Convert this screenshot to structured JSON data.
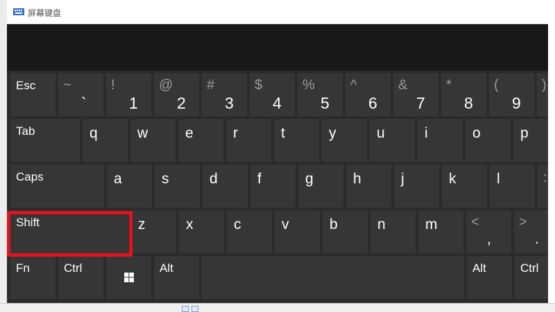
{
  "window": {
    "title": "屏幕键盘",
    "title_icon": "keyboard-icon"
  },
  "keys": {
    "esc": "Esc",
    "tab": "Tab",
    "caps": "Caps",
    "shift": "Shift",
    "fn": "Fn",
    "ctrl_left": "Ctrl",
    "alt_left": "Alt",
    "alt_right": "Alt",
    "ctrl_right": "Ctrl",
    "windows": "windows-logo-icon"
  },
  "number_row": [
    {
      "top": "~",
      "bottom": "`"
    },
    {
      "top": "!",
      "bottom": "1"
    },
    {
      "top": "@",
      "bottom": "2"
    },
    {
      "top": "#",
      "bottom": "3"
    },
    {
      "top": "$",
      "bottom": "4"
    },
    {
      "top": "%",
      "bottom": "5"
    },
    {
      "top": "^",
      "bottom": "6"
    },
    {
      "top": "&",
      "bottom": "7"
    },
    {
      "top": "*",
      "bottom": "8"
    },
    {
      "top": "(",
      "bottom": "9"
    },
    {
      "top": ")",
      "bottom": ""
    }
  ],
  "row_q": [
    "q",
    "w",
    "e",
    "r",
    "t",
    "y",
    "u",
    "i",
    "o",
    "p"
  ],
  "row_a": [
    "a",
    "s",
    "d",
    "f",
    "g",
    "h",
    "j",
    "k",
    "l"
  ],
  "row_a_extra": {
    "top": ":",
    "bottom": ";"
  },
  "row_z": [
    "z",
    "x",
    "c",
    "v",
    "b",
    "n",
    "m"
  ],
  "row_z_extra": [
    {
      "top": "<",
      "bottom": ","
    },
    {
      "top": ">",
      "bottom": "."
    }
  ],
  "colors": {
    "key_bg": "#363636",
    "keyboard_bg": "#2b2b2b",
    "display_bg": "#181818",
    "highlight": "#e0141e"
  }
}
